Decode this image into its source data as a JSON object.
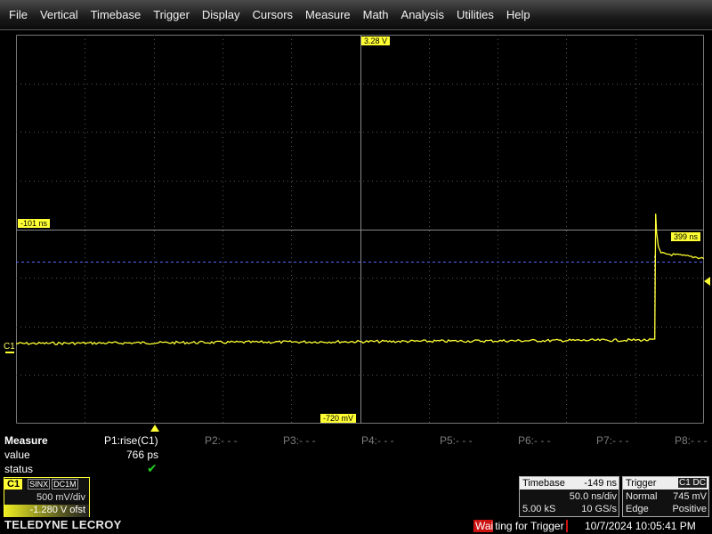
{
  "menu": [
    "File",
    "Vertical",
    "Timebase",
    "Trigger",
    "Display",
    "Cursors",
    "Measure",
    "Math",
    "Analysis",
    "Utilities",
    "Help"
  ],
  "grid": {
    "cursor_top_label": "3.28 V",
    "cursor_bottom_label": "-720 mV",
    "time_left_label": "-101 ns",
    "time_right_label": "399 ns"
  },
  "trace": {
    "channel": "C1",
    "color": "#ffff33",
    "low_level_V": -1.13,
    "high_level_V": 1.06,
    "overshoot_peak_V": 1.64,
    "edge_time_ns": -101,
    "time_start_ns": -399,
    "time_end_ns": 101
  },
  "measure": {
    "title": "Measure",
    "value_label": "value",
    "status_label": "status",
    "p1_name": "P1:rise(C1)",
    "p1_value": "766 ps",
    "p1_status": "✔",
    "slots": [
      "P2:- - -",
      "P3:- - -",
      "P4:- - -",
      "P5:- - -",
      "P6:- - -",
      "P7:- - -",
      "P8:- - -"
    ]
  },
  "channel": {
    "label": "C1",
    "flags": [
      "SINX",
      "DC1M"
    ],
    "scale": "500 mV/div",
    "offset": "-1.280 V ofst"
  },
  "timebase": {
    "title": "Timebase",
    "delay": "-149 ns",
    "scale": "50.0 ns/div",
    "points": "5.00 kS",
    "rate": "10 GS/s"
  },
  "trigger": {
    "title": "Trigger",
    "source": "C1 DC",
    "mode": "Normal",
    "level": "745 mV",
    "type": "Edge",
    "slope": "Positive"
  },
  "brand": "TELEDYNE LECROY",
  "status": {
    "trigger_state_highlight": "Wai",
    "trigger_state_rest": "ting for Trigger",
    "datetime": "10/7/2024 10:05:41 PM"
  }
}
